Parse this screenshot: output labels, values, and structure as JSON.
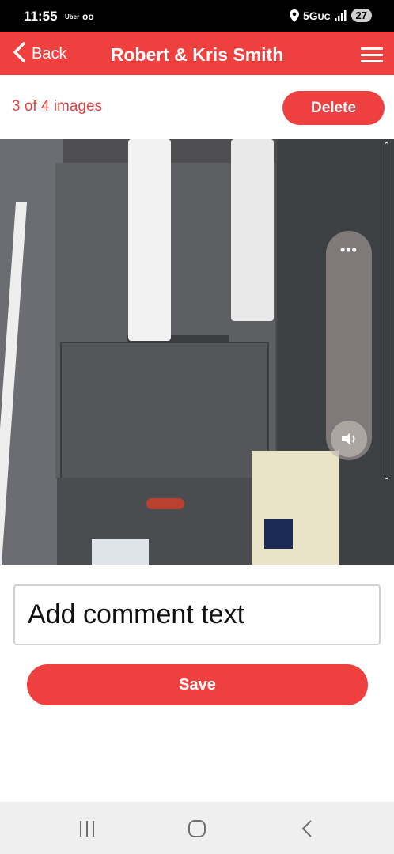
{
  "status_bar": {
    "time": "11:55",
    "app_indicator": "Uber",
    "voicemail_icon": "ᴏᴏ",
    "network": "5G",
    "network_suffix": "UC",
    "battery": "27",
    "icons": [
      "location-icon",
      "signal-icon",
      "voicemail-icon"
    ]
  },
  "header": {
    "back_label": "Back",
    "title": "Robert & Kris Smith",
    "menu_icon": "hamburger-menu-icon",
    "background_color": "#ef4040"
  },
  "toolbar": {
    "image_counter": "3 of 4 images",
    "delete_label": "Delete"
  },
  "photo_overlay": {
    "more_label": "•••",
    "volume_icon": "volume-icon"
  },
  "comment": {
    "placeholder": "Add comment text",
    "value": ""
  },
  "actions": {
    "save_label": "Save"
  },
  "nav": {
    "recents_icon": "recents-icon",
    "home_icon": "home-icon",
    "back_icon": "back-icon"
  },
  "colors": {
    "accent": "#ef4040",
    "status_bar": "#000000",
    "nav_bar": "#efefef"
  }
}
